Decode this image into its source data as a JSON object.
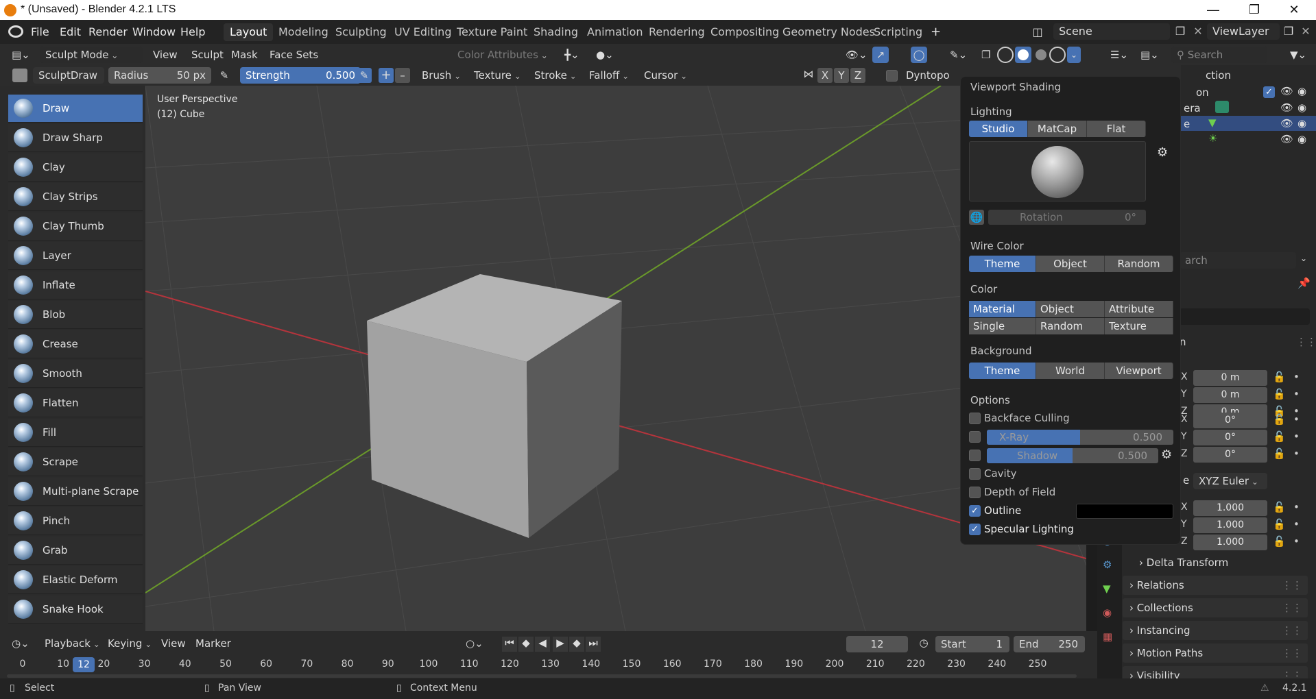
{
  "window": {
    "title": "* (Unsaved) - Blender 4.2.1 LTS",
    "minimize": "—",
    "maximize": "❐",
    "close": "✕"
  },
  "menus": [
    "File",
    "Edit",
    "Render",
    "Window",
    "Help"
  ],
  "workspaces": [
    "Layout",
    "Modeling",
    "Sculpting",
    "UV Editing",
    "Texture Paint",
    "Shading",
    "Animation",
    "Rendering",
    "Compositing",
    "Geometry Nodes",
    "Scripting"
  ],
  "add_workspace": "+",
  "scene": "Scene",
  "view_layer": "ViewLayer",
  "tool_header": {
    "mode": "Sculpt Mode",
    "menus": [
      "View",
      "Sculpt",
      "Mask",
      "Face Sets"
    ],
    "color_attributes": "Color Attributes",
    "search_placeholder": "Search"
  },
  "brush_header": {
    "brush_name": "SculptDraw",
    "radius_label": "Radius",
    "radius_value": "50 px",
    "strength_label": "Strength",
    "strength_value": "0.500",
    "plus": "+",
    "minus": "–",
    "menus": [
      "Brush",
      "Texture",
      "Stroke",
      "Falloff",
      "Cursor"
    ],
    "axes": [
      "X",
      "Y",
      "Z"
    ],
    "dyntopo": "Dyntopo"
  },
  "viewport": {
    "perspective": "User Perspective",
    "object": "(12) Cube"
  },
  "tools": [
    "Draw",
    "Draw Sharp",
    "Clay",
    "Clay Strips",
    "Clay Thumb",
    "Layer",
    "Inflate",
    "Blob",
    "Crease",
    "Smooth",
    "Flatten",
    "Fill",
    "Scrape",
    "Multi-plane Scrape",
    "Pinch",
    "Grab",
    "Elastic Deform",
    "Snake Hook"
  ],
  "shading_popup": {
    "title": "Viewport Shading",
    "lighting_label": "Lighting",
    "lighting": [
      "Studio",
      "MatCap",
      "Flat"
    ],
    "rotation_label": "Rotation",
    "rotation_value": "0°",
    "wire_color_label": "Wire Color",
    "wire_color": [
      "Theme",
      "Object",
      "Random"
    ],
    "color_label": "Color",
    "color_row1": [
      "Material",
      "Object",
      "Attribute"
    ],
    "color_row2": [
      "Single",
      "Random",
      "Texture"
    ],
    "background_label": "Background",
    "background": [
      "Theme",
      "World",
      "Viewport"
    ],
    "options_label": "Options",
    "backface": "Backface Culling",
    "xray": "X-Ray",
    "xray_value": "0.500",
    "xray_level": 0.5,
    "shadow": "Shadow",
    "shadow_value": "0.500",
    "shadow_level": 0.5,
    "cavity": "Cavity",
    "dof": "Depth of Field",
    "outline": "Outline",
    "specular": "Specular Lighting"
  },
  "outliner": {
    "header": "ction",
    "rows": [
      "on",
      "era",
      "e",
      ""
    ]
  },
  "properties": {
    "search_placeholder": "arch",
    "section": "n",
    "axes": [
      "X",
      "Y",
      "Z"
    ],
    "location": [
      "0 m",
      "0 m",
      "0 m"
    ],
    "rotation": [
      "0°",
      "0°",
      "0°"
    ],
    "mode_label": "e",
    "rotation_mode": "XYZ Euler",
    "scale": [
      "1.000",
      "1.000",
      "1.000"
    ],
    "panels": [
      "Delta Transform",
      "Relations",
      "Collections",
      "Instancing",
      "Motion Paths",
      "Visibility"
    ]
  },
  "timeline": {
    "menus": [
      "Playback",
      "Keying",
      "View",
      "Marker"
    ],
    "current_frame": "12",
    "start_label": "Start",
    "start_value": "1",
    "end_label": "End",
    "end_value": "250",
    "frame_marker": "12",
    "ticks": [
      "0",
      "10",
      "20",
      "30",
      "40",
      "50",
      "60",
      "70",
      "80",
      "90",
      "100",
      "110",
      "120",
      "130",
      "140",
      "150",
      "160",
      "170",
      "180",
      "190",
      "200",
      "210",
      "220",
      "230",
      "240",
      "250"
    ]
  },
  "statusbar": {
    "select": "Select",
    "pan": "Pan View",
    "context": "Context Menu",
    "version": "4.2.1"
  },
  "colors": {
    "accent": "#4772b3",
    "panel": "#2b2b2b",
    "viewport": "#3d3d3d",
    "x_axis": "#b5343c",
    "y_axis": "#6a9a2a"
  }
}
